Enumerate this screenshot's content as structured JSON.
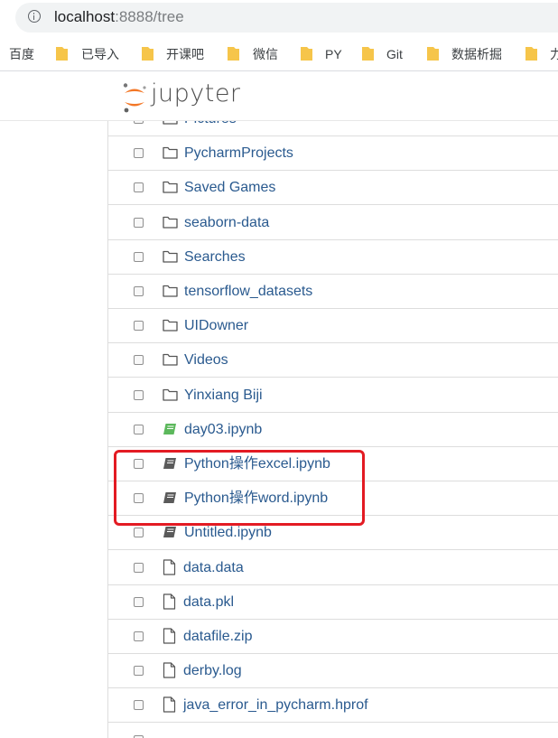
{
  "browser": {
    "url_host": "localhost",
    "url_path": ":8888/tree",
    "bookmarks": [
      {
        "label": "百度",
        "has_folder": false
      },
      {
        "label": "已导入",
        "has_folder": true
      },
      {
        "label": "开课吧",
        "has_folder": true
      },
      {
        "label": "微信",
        "has_folder": true
      },
      {
        "label": "PY",
        "has_folder": true
      },
      {
        "label": "Git",
        "has_folder": true
      },
      {
        "label": "数据析掘",
        "has_folder": true
      },
      {
        "label": "力",
        "has_folder": true
      }
    ],
    "folder_color": "#f6c54a"
  },
  "header": {
    "brand": "jupyter",
    "logo_color": "#f37726"
  },
  "file_list": {
    "items": [
      {
        "name": "Pictures",
        "type": "folder"
      },
      {
        "name": "PycharmProjects",
        "type": "folder"
      },
      {
        "name": "Saved Games",
        "type": "folder"
      },
      {
        "name": "seaborn-data",
        "type": "folder"
      },
      {
        "name": "Searches",
        "type": "folder"
      },
      {
        "name": "tensorflow_datasets",
        "type": "folder"
      },
      {
        "name": "UIDowner",
        "type": "folder"
      },
      {
        "name": "Videos",
        "type": "folder"
      },
      {
        "name": "Yinxiang Biji",
        "type": "folder"
      },
      {
        "name": "day03.ipynb",
        "type": "notebook-running"
      },
      {
        "name": "Python操作excel.ipynb",
        "type": "notebook"
      },
      {
        "name": "Python操作word.ipynb",
        "type": "notebook"
      },
      {
        "name": "Untitled.ipynb",
        "type": "notebook"
      },
      {
        "name": "data.data",
        "type": "file"
      },
      {
        "name": "data.pkl",
        "type": "file"
      },
      {
        "name": "datafile.zip",
        "type": "file"
      },
      {
        "name": "derby.log",
        "type": "file"
      },
      {
        "name": "java_error_in_pycharm.hprof",
        "type": "file"
      }
    ],
    "colors": {
      "link": "#2a5a8f",
      "running_notebook": "#5cb85c",
      "notebook": "#5a5a5a",
      "annotation": "#e31b23"
    }
  }
}
